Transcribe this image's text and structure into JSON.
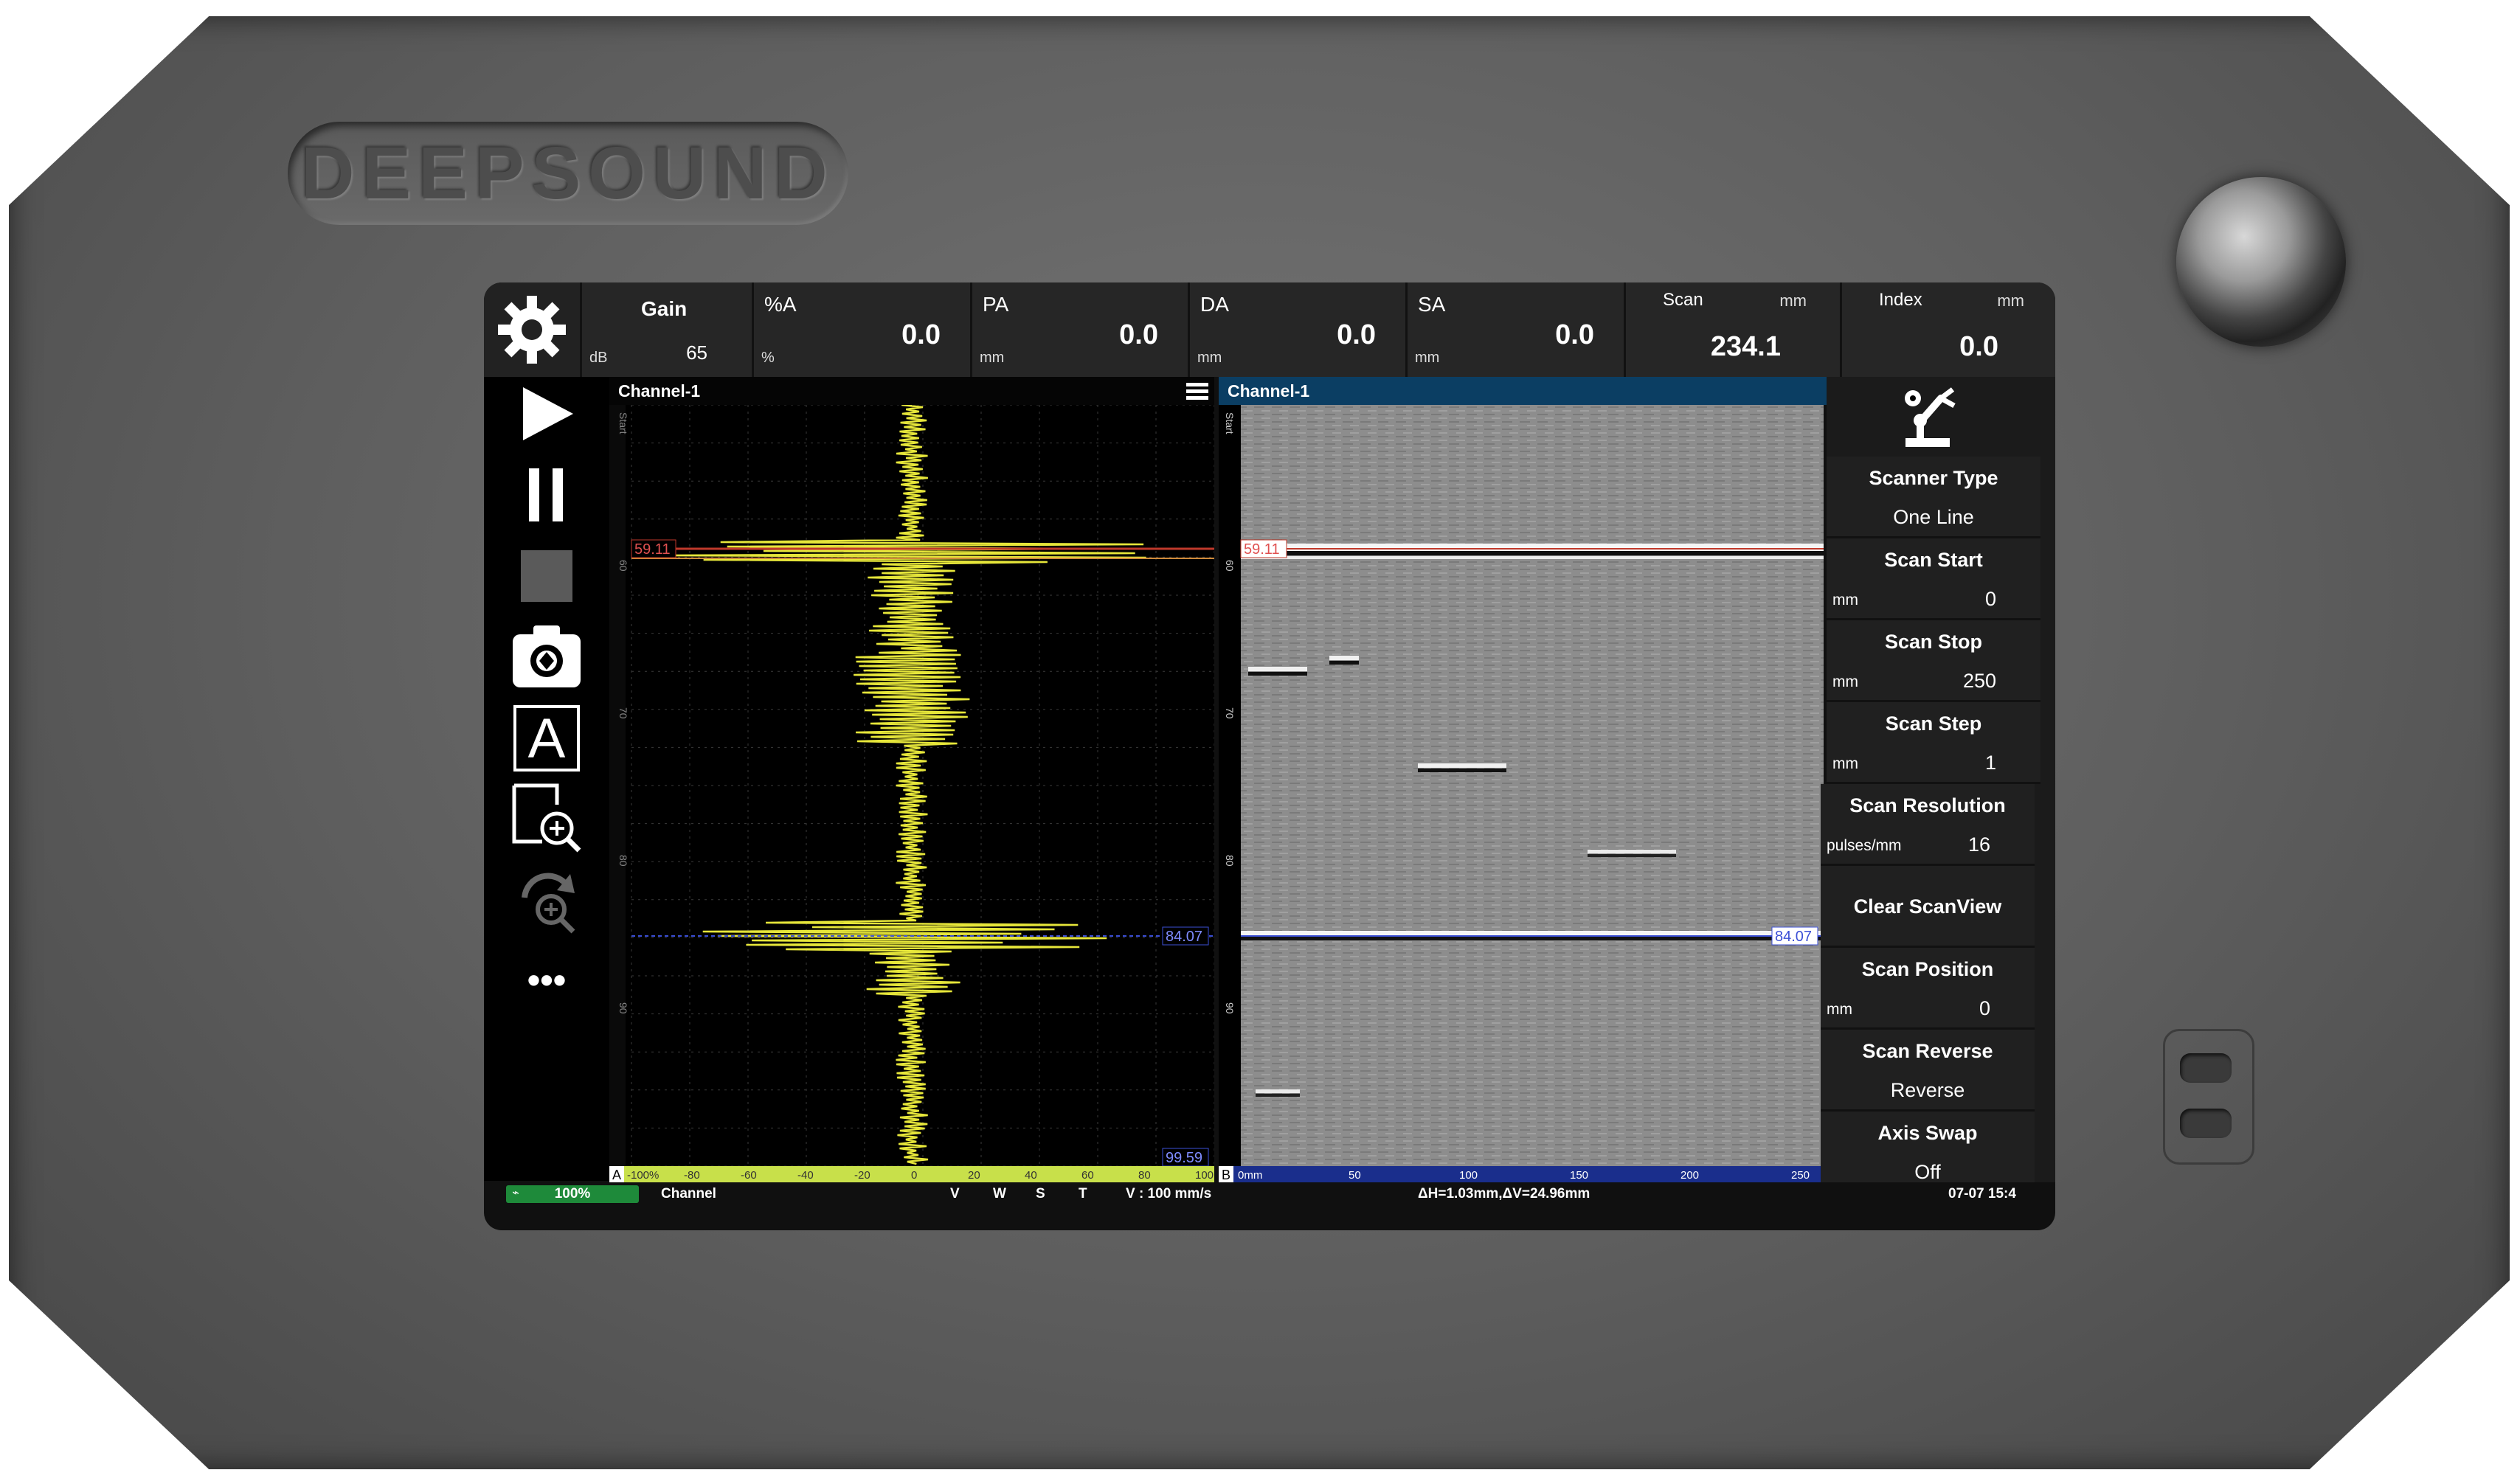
{
  "device": {
    "brand": "DEEPSOUND"
  },
  "topbar": {
    "fields": [
      {
        "name": "Gain",
        "unit": "dB",
        "value": "65"
      },
      {
        "name": "%A",
        "unit": "%",
        "value": "0.0"
      },
      {
        "name": "PA",
        "unit": "mm",
        "value": "0.0"
      },
      {
        "name": "DA",
        "unit": "mm",
        "value": "0.0"
      },
      {
        "name": "SA",
        "unit": "mm",
        "value": "0.0"
      },
      {
        "name": "Scan",
        "unit": "mm",
        "value": "234.1"
      },
      {
        "name": "Index",
        "unit": "mm",
        "value": "0.0"
      }
    ]
  },
  "toolbar": {
    "icons": [
      "gear-icon",
      "play-icon",
      "pause-icon",
      "stop-icon",
      "camera-icon",
      "a-text-icon",
      "zoom-icon",
      "reset-zoom-icon",
      "more-icon"
    ],
    "a_label": "A",
    "more": "•••"
  },
  "ascan": {
    "title": "Channel-1",
    "gate1_label": "59.11",
    "gate2_label": "84.07",
    "bottom_label": "99.59",
    "axis_letter": "A",
    "x_ticks": [
      "-100%",
      "-80",
      "-60",
      "-40",
      "-20",
      "0",
      "20",
      "40",
      "60",
      "80",
      "100"
    ],
    "y_ticks": [
      "Start",
      "60",
      "70",
      "80",
      "90"
    ],
    "colors": {
      "wave": "#e6e63a",
      "gate1": "#c0392b",
      "gate2": "#3b4fd6",
      "axis": "#c8e04a"
    }
  },
  "bscan": {
    "title": "Channel-1",
    "gate1_label": "59.11",
    "gate2_label": "84.07",
    "axis_letter": "B",
    "x_ticks": [
      "0mm",
      "50",
      "100",
      "150",
      "200",
      "250"
    ],
    "y_ticks": [
      "Start",
      "60",
      "70",
      "80",
      "90"
    ]
  },
  "rpanel": {
    "items": [
      {
        "title": "Scanner Type",
        "unit": "",
        "value": "One Line"
      },
      {
        "title": "Scan Start",
        "unit": "mm",
        "value": "0"
      },
      {
        "title": "Scan Stop",
        "unit": "mm",
        "value": "250"
      },
      {
        "title": "Scan Step",
        "unit": "mm",
        "value": "1"
      },
      {
        "title": "Scan Resolution",
        "unit": "pulses/mm",
        "value": "16"
      },
      {
        "title": "Clear ScanView",
        "unit": "",
        "value": ""
      },
      {
        "title": "Scan Position",
        "unit": "mm",
        "value": "0"
      },
      {
        "title": "Scan Reverse",
        "unit": "",
        "value": "Reverse"
      },
      {
        "title": "Axis Swap",
        "unit": "",
        "value": "Off"
      }
    ]
  },
  "statusbar": {
    "battery": "100%",
    "channel": "Channel",
    "v": "V",
    "w": "W",
    "s": "S",
    "t": "T",
    "velocity": "V : 100 mm/s",
    "delta": "ΔH=1.03mm,ΔV=24.96mm",
    "datetime": "07-07 15:4"
  }
}
